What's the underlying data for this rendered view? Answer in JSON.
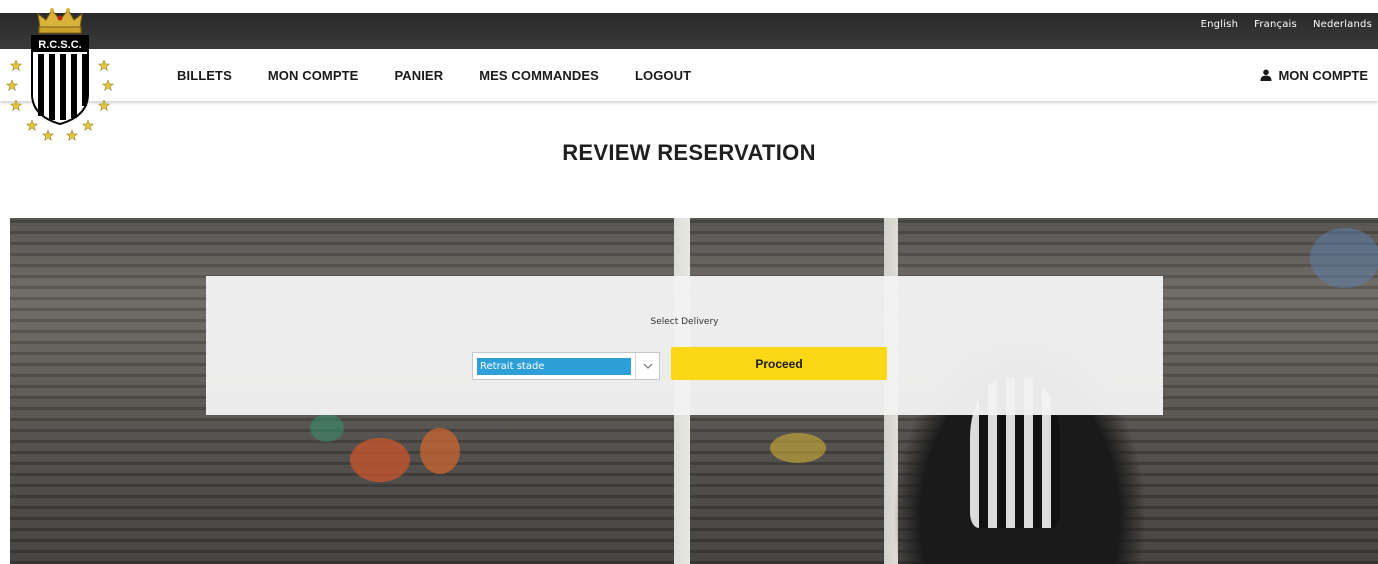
{
  "languages": [
    "English",
    "Français",
    "Nederlands"
  ],
  "logo": {
    "text": "R.C.S.C."
  },
  "nav": {
    "items": [
      "BILLETS",
      "MON COMPTE",
      "PANIER",
      "MES COMMANDES",
      "LOGOUT"
    ],
    "account_label": "MON COMPTE",
    "account_icon": "user-icon"
  },
  "page": {
    "title": "REVIEW RESERVATION"
  },
  "delivery": {
    "label": "Select Delivery",
    "selected": "Retrait stade",
    "proceed_label": "Proceed"
  },
  "colors": {
    "accent": "#fbd716",
    "select_highlight": "#2f9fd8",
    "topbar": "#2f2f2f"
  }
}
